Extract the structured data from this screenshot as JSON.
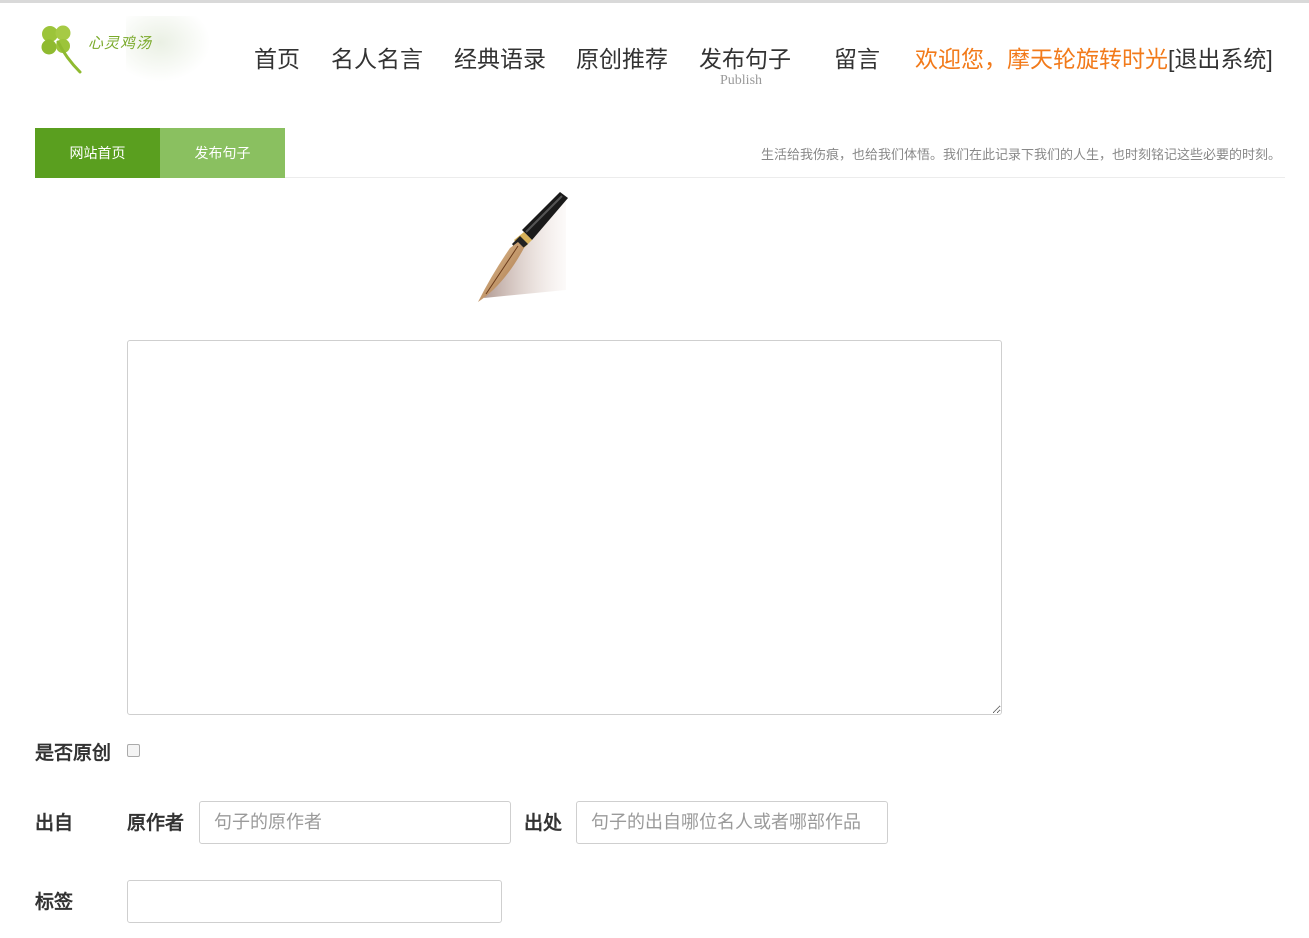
{
  "header": {
    "logo_text": "心灵鸡汤",
    "nav": [
      {
        "label": "首页"
      },
      {
        "label": "名人名言"
      },
      {
        "label": "经典语录"
      },
      {
        "label": "原创推荐"
      },
      {
        "label": "发布句子",
        "sublabel": "Publish"
      },
      {
        "label": "留言"
      }
    ],
    "welcome": "欢迎您，摩天轮旋转时光",
    "logout": "[退出系统]"
  },
  "tabs": {
    "home": "网站首页",
    "publish": "发布句子",
    "slogan": "生活给我伤痕，也给我们体悟。我们在此记录下我们的人生，也时刻铭记这些必要的时刻。"
  },
  "form": {
    "content_value": "",
    "original_label": "是否原创",
    "source_label": "出自",
    "author_label": "原作者",
    "author_placeholder": "句子的原作者",
    "origin_label": "出处",
    "origin_placeholder": "句子的出自哪位名人或者哪部作品",
    "tags_label": "标签",
    "tags_value": ""
  },
  "colors": {
    "accent_green": "#5a9f1f",
    "light_green": "#8ac060",
    "welcome_orange": "#f27a1a"
  }
}
